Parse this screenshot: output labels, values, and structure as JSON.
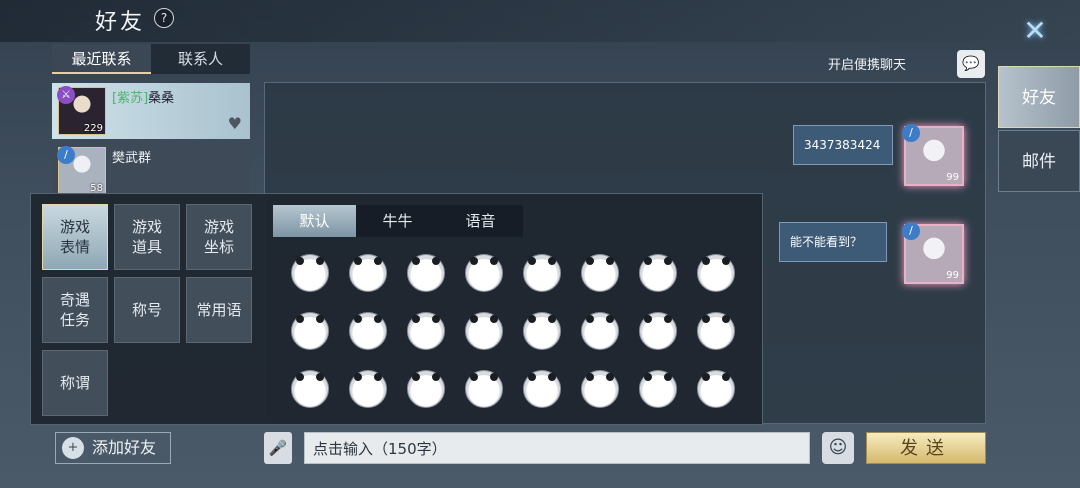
{
  "header": {
    "title": "好友",
    "help_icon": "?"
  },
  "contact_tabs": [
    "最近联系",
    "联系人"
  ],
  "contacts": [
    {
      "guild": "[紫苏]",
      "name": "桑桑",
      "level": "229",
      "badge_icon": "class-icon"
    },
    {
      "name": "樊武群",
      "level": "58",
      "badge_icon": "sword-icon"
    }
  ],
  "chat": {
    "portable_label": "开启便携聊天",
    "messages": [
      {
        "text": "3437383424",
        "level": "99"
      },
      {
        "text": "能不能看到？",
        "level": "99"
      }
    ]
  },
  "side_tabs": [
    "好友",
    "邮件"
  ],
  "emoji_panel": {
    "categories": [
      "游戏\n表情",
      "游戏\n道具",
      "游戏\n坐标",
      "奇遇\n任务",
      "称号",
      "常用语",
      "称谓"
    ],
    "tabs": [
      "默认",
      "牛牛",
      "语音"
    ],
    "emoji_count": 24
  },
  "bottom": {
    "add_friend_label": "添加好友",
    "input_placeholder": "点击输入（150字）",
    "send_label": "发送"
  },
  "colors": {
    "accent_gold": "#d6b96c",
    "guild_green": "#4bb36a",
    "bubble": "#3d5a76"
  }
}
